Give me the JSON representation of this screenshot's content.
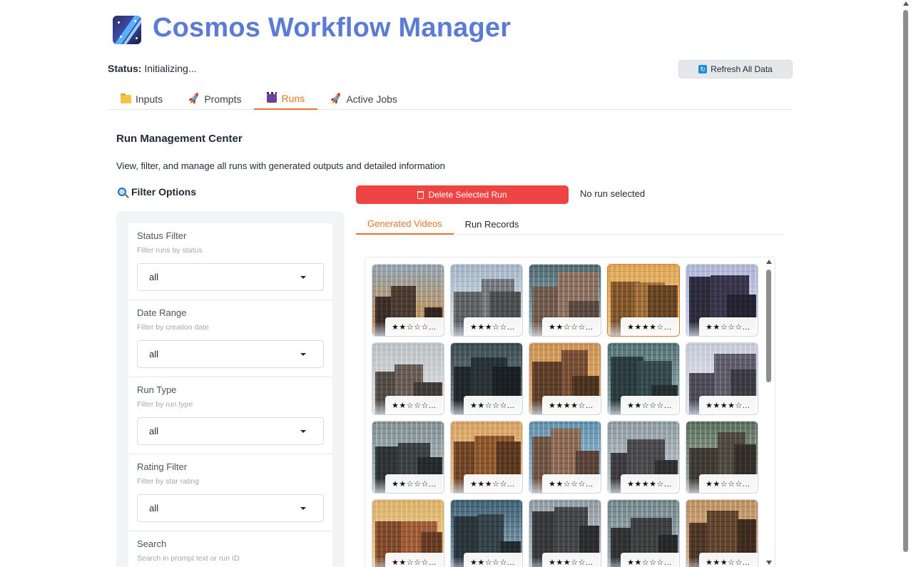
{
  "app": {
    "title": "Cosmos Workflow Manager"
  },
  "status": {
    "label": "Status:",
    "value": "Initializing..."
  },
  "toolbar": {
    "refresh_label": "Refresh All Data"
  },
  "tabs": [
    {
      "label": "Inputs",
      "icon": "folder-icon",
      "active": false
    },
    {
      "label": "Prompts",
      "icon": "rocket-icon",
      "active": false
    },
    {
      "label": "Runs",
      "icon": "clapper-icon",
      "active": true
    },
    {
      "label": "Active Jobs",
      "icon": "rocket-icon",
      "active": false
    }
  ],
  "section": {
    "title": "Run Management Center",
    "description": "View, filter, and manage all runs with generated outputs and detailed information"
  },
  "filters": {
    "heading": "Filter Options",
    "heading_icon": "magnifier-icon",
    "items": [
      {
        "label": "Status Filter",
        "hint": "Filter runs by status",
        "value": "all"
      },
      {
        "label": "Date Range",
        "hint": "Filter by creation date",
        "value": "all"
      },
      {
        "label": "Run Type",
        "hint": "Filter by run type",
        "value": "all"
      },
      {
        "label": "Rating Filter",
        "hint": "Filter by star rating",
        "value": "all"
      },
      {
        "label": "Search",
        "hint": "Search in prompt text or run ID",
        "value": ""
      }
    ]
  },
  "actions": {
    "delete_label": "Delete Selected Run",
    "selection_status": "No run selected"
  },
  "subtabs": [
    {
      "label": "Generated Videos",
      "active": true
    },
    {
      "label": "Run Records",
      "active": false
    }
  ],
  "gallery": {
    "selected_index": 3,
    "items": [
      {
        "rating": "★★☆☆☆...",
        "palette": [
          "#8fa3b5",
          "#3a2e2a",
          "#c98a4a"
        ]
      },
      {
        "rating": "★★★☆☆...",
        "palette": [
          "#9fb3c7",
          "#5a5f68",
          "#e0e6ec"
        ]
      },
      {
        "rating": "★★☆☆☆...",
        "palette": [
          "#4d6a78",
          "#6b5a52",
          "#a3b8c2"
        ]
      },
      {
        "rating": "★★★★☆...",
        "palette": [
          "#d9a35c",
          "#7a5530",
          "#efc98a"
        ]
      },
      {
        "rating": "★★☆☆☆...",
        "palette": [
          "#aab4d6",
          "#2c2a3e",
          "#cfd6ec"
        ]
      },
      {
        "rating": "★★☆☆☆...",
        "palette": [
          "#b9c1c7",
          "#4f4a48",
          "#dfe3e6"
        ]
      },
      {
        "rating": "★★☆☆☆...",
        "palette": [
          "#3a4b55",
          "#1f272d",
          "#7a8b95"
        ]
      },
      {
        "rating": "★★★★☆...",
        "palette": [
          "#c7925a",
          "#5a3e2c",
          "#e4b27a"
        ]
      },
      {
        "rating": "★★☆☆☆...",
        "palette": [
          "#52707a",
          "#2a3a40",
          "#9ab2ba"
        ]
      },
      {
        "rating": "★★★★☆...",
        "palette": [
          "#c3c9d8",
          "#4a4a5a",
          "#e6e9f0"
        ]
      },
      {
        "rating": "★★☆☆☆...",
        "palette": [
          "#7d8f98",
          "#2d3438",
          "#b5c2c8"
        ]
      },
      {
        "rating": "★★★☆☆...",
        "palette": [
          "#d3a06a",
          "#6b4529",
          "#edc796"
        ]
      },
      {
        "rating": "★★☆☆☆...",
        "palette": [
          "#5f8fb0",
          "#6a5348",
          "#a8c8dc"
        ]
      },
      {
        "rating": "★★★★☆...",
        "palette": [
          "#8a9aa6",
          "#3a3a40",
          "#c2ccd3"
        ]
      },
      {
        "rating": "★★☆☆☆...",
        "palette": [
          "#5a6e64",
          "#3d3a36",
          "#a5b3aa"
        ]
      },
      {
        "rating": "★★☆☆☆...",
        "palette": [
          "#d8b070",
          "#7a4a30",
          "#f0d29a"
        ]
      },
      {
        "rating": "★★☆☆☆...",
        "palette": [
          "#3f6078",
          "#28343c",
          "#8aa8be"
        ]
      },
      {
        "rating": "★★★☆☆...",
        "palette": [
          "#8c9aa6",
          "#34373c",
          "#c0c8cf"
        ]
      },
      {
        "rating": "★★☆☆☆...",
        "palette": [
          "#6f8590",
          "#2e3236",
          "#aab8c0"
        ]
      },
      {
        "rating": "★★★☆☆...",
        "palette": [
          "#b8906a",
          "#4a3628",
          "#d8b896"
        ]
      }
    ]
  }
}
